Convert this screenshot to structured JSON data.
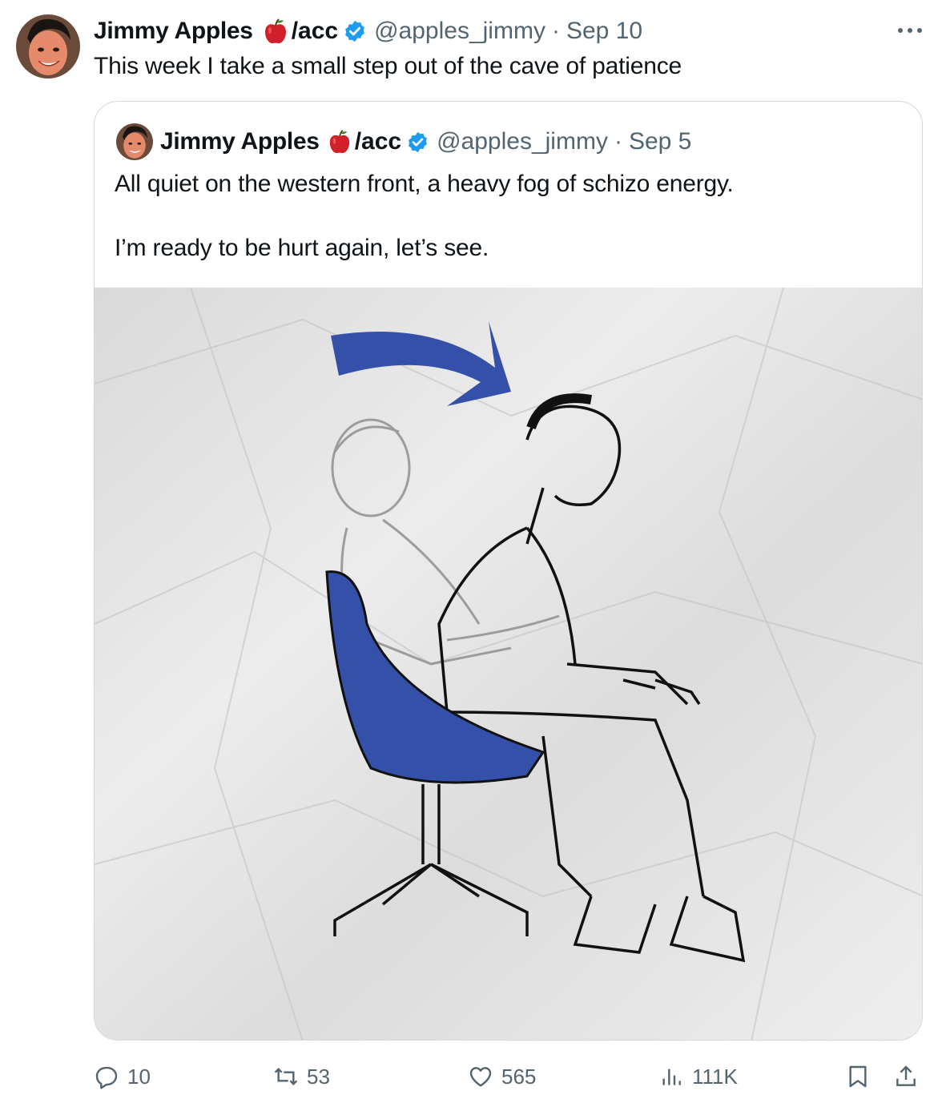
{
  "tweet": {
    "author_name": "Jimmy Apples",
    "name_suffix": "/acc",
    "handle": "@apples_jimmy",
    "separator": "·",
    "date": "Sep 10",
    "text": "This week I take a small step out of the cave of patience"
  },
  "quoted_tweet": {
    "author_name": "Jimmy Apples",
    "name_suffix": "/acc",
    "handle": "@apples_jimmy",
    "separator": "·",
    "date": "Sep 5",
    "text_line1": "All quiet on the western front, a heavy fog of schizo energy.",
    "text_line2": "I’m ready to be hurt again, let’s see."
  },
  "actions": {
    "replies": "10",
    "reposts": "53",
    "likes": "565",
    "views": "111K"
  },
  "colors": {
    "text": "#0f1419",
    "secondary": "#536471",
    "verified": "#1d9bf0",
    "border": "#cfd9de",
    "chair_blue": "#3550a8",
    "apple_red": "#d1202a"
  },
  "icons": [
    "more-icon",
    "apple-emoji-icon",
    "verified-badge-icon",
    "reply-icon",
    "retweet-icon",
    "like-icon",
    "views-icon",
    "bookmark-icon",
    "share-icon"
  ]
}
